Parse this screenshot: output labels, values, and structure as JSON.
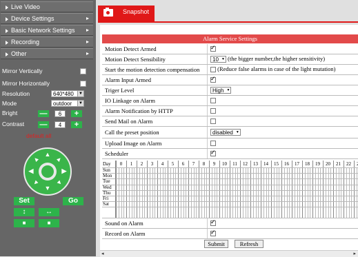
{
  "nav": [
    {
      "label": "Live Video",
      "arrow": ""
    },
    {
      "label": "Device Settings",
      "arrow": "▸"
    },
    {
      "label": "Basic Network Settings",
      "arrow": "▸"
    },
    {
      "label": "Recording",
      "arrow": "▸"
    },
    {
      "label": "Other",
      "arrow": "▸"
    }
  ],
  "controls": {
    "mirror_vertically": "Mirror Vertically",
    "mirror_horizontally": "Mirror Horizontally",
    "resolution_label": "Resolution",
    "resolution_value": "640*480",
    "mode_label": "Mode",
    "mode_value": "outdoor",
    "bright_label": "Bright",
    "bright_value": "6",
    "contrast_label": "Contrast",
    "contrast_value": "4",
    "minus": "—",
    "plus": "+",
    "default_all": "default all"
  },
  "ptz": {
    "set": "Set",
    "go": "Go",
    "vflip": "↕",
    "hflip": "↔",
    "sq1": "■",
    "sq2": "■"
  },
  "tab": {
    "label": "Snapshot"
  },
  "panel": {
    "title": "Alarm Service Settings"
  },
  "rows": [
    {
      "label": "Motion Detect Armed",
      "checked": true
    },
    {
      "label": "Motion Detect Sensibility",
      "select": "10",
      "note": "(the bigger number,the higher sensitivity)"
    },
    {
      "label": "Start the motion detection compensation",
      "checked": false,
      "note": "(Reduce false alarms in case of the light mutation)"
    },
    {
      "label": "Alarm Input Armed",
      "checked": true
    },
    {
      "label": "Triger Level",
      "select": "High"
    },
    {
      "label": "IO Linkage on Alarm",
      "checked": false
    },
    {
      "label": "Alarm Notification by HTTP",
      "checked": false
    },
    {
      "label": "Send Mail on Alarm",
      "checked": false
    },
    {
      "label": "Call the preset position",
      "select": "disabled"
    },
    {
      "label": "Upload Image on Alarm",
      "checked": false
    },
    {
      "label": "Scheduler",
      "checked": true
    }
  ],
  "scheduler": {
    "corner": "Day",
    "hours": [
      "0",
      "1",
      "2",
      "3",
      "4",
      "5",
      "6",
      "7",
      "8",
      "9",
      "10",
      "11",
      "12",
      "13",
      "14",
      "15",
      "16",
      "17",
      "18",
      "19",
      "20",
      "21",
      "22",
      "23"
    ],
    "days": [
      "Sun",
      "Mon",
      "Tue",
      "Wed",
      "Thu",
      "Fri",
      "Sat"
    ]
  },
  "rows_bottom": [
    {
      "label": "Sound on Alarm",
      "checked": true
    },
    {
      "label": "Record on Alarm",
      "checked": true
    }
  ],
  "buttons": {
    "submit": "Submit",
    "refresh": "Refresh"
  },
  "scroll": {
    "left": "◂",
    "right": "▸"
  }
}
